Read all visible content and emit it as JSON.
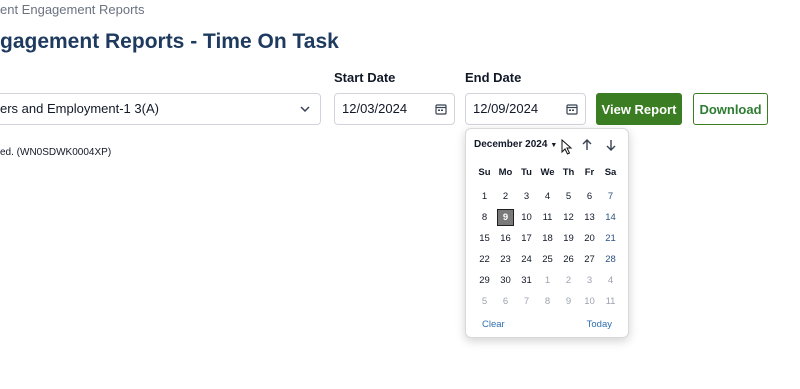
{
  "breadcrumb": "ent Engagement Reports",
  "page_title": "gagement Reports - Time On Task",
  "filters": {
    "course_select": {
      "value": "ers and Employment-1 3(A)"
    },
    "start_date": {
      "label": "Start Date",
      "value": "12/03/2024"
    },
    "end_date": {
      "label": "End Date",
      "value": "12/09/2024"
    }
  },
  "buttons": {
    "view_report": "View Report",
    "download": "Download"
  },
  "info_text": "ed. (WN0SDWK0004XP)",
  "calendar": {
    "month_label": "December 2024",
    "weekdays": [
      "Su",
      "Mo",
      "Tu",
      "We",
      "Th",
      "Fr",
      "Sa"
    ],
    "days": [
      "1",
      "2",
      "3",
      "4",
      "5",
      "6",
      "7",
      "8",
      "9",
      "10",
      "11",
      "12",
      "13",
      "14",
      "15",
      "16",
      "17",
      "18",
      "19",
      "20",
      "21",
      "22",
      "23",
      "24",
      "25",
      "26",
      "27",
      "28",
      "29",
      "30",
      "31",
      "1",
      "2",
      "3",
      "4",
      "5",
      "6",
      "7",
      "8",
      "9",
      "10",
      "11"
    ],
    "selected_day": "9",
    "clear_label": "Clear",
    "today_label": "Today"
  },
  "colors": {
    "primary_green": "#3a7d22",
    "title_navy": "#1e3a5f",
    "link_blue": "#2f6fb0",
    "selected_day_bg": "#7a7a7a"
  },
  "icons": {
    "select_chevron": "chevron-down-icon",
    "date_picker": "calendar-icon",
    "month_prev": "arrow-up-icon",
    "month_next": "arrow-down-icon",
    "pointer": "mouse-cursor-icon"
  }
}
